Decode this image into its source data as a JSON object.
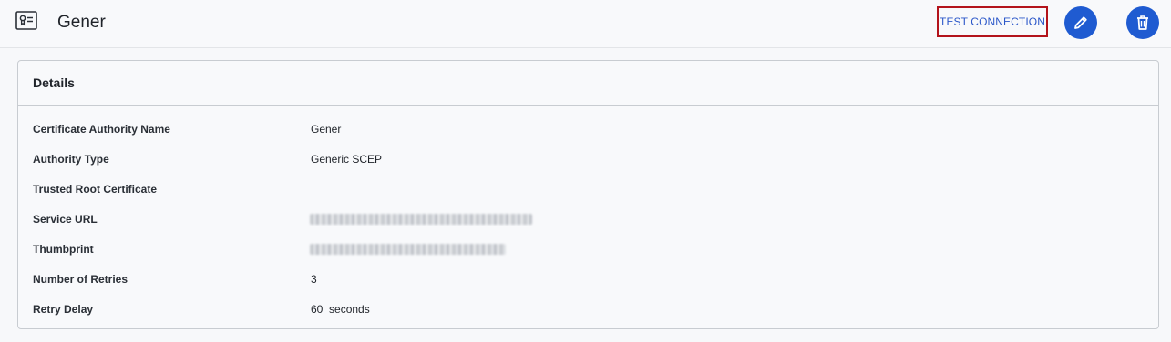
{
  "header": {
    "title": "Gener",
    "icon": "certificate-icon",
    "test_connection_label": "TEST CONNECTION",
    "edit_icon": "pencil-icon",
    "delete_icon": "trash-icon",
    "accent_color": "#1f5bd1",
    "highlight_color": "#b3131b"
  },
  "details": {
    "title": "Details",
    "rows": [
      {
        "label": "Certificate Authority Name",
        "value": "Gener"
      },
      {
        "label": "Authority Type",
        "value": "Generic SCEP"
      },
      {
        "label": "Trusted Root Certificate",
        "value": ""
      },
      {
        "label": "Service URL",
        "value": ""
      },
      {
        "label": "Thumbprint",
        "value": ""
      },
      {
        "label": "Number of Retries",
        "value": "3"
      },
      {
        "label": "Retry Delay",
        "value": "60  seconds"
      }
    ]
  }
}
